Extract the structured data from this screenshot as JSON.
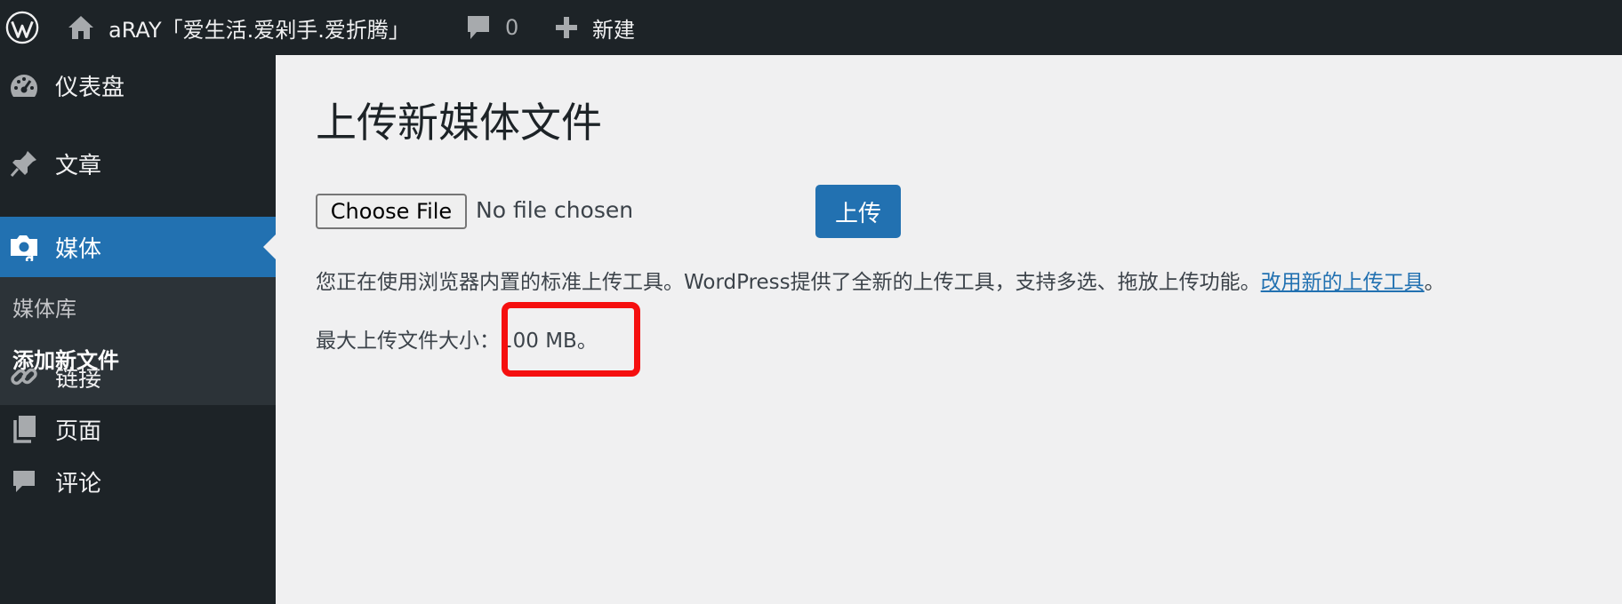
{
  "adminbar": {
    "site_name": "aRAY「爱生活.爱剁手.爱折腾」",
    "comments_count": "0",
    "new_label": "新建"
  },
  "sidebar": {
    "items": [
      {
        "label": "仪表盘",
        "icon": "dashboard-icon"
      },
      {
        "label": "文章",
        "icon": "pushpin-icon"
      },
      {
        "label": "媒体",
        "icon": "media-icon"
      },
      {
        "label": "链接",
        "icon": "link-icon"
      },
      {
        "label": "页面",
        "icon": "pages-icon"
      },
      {
        "label": "评论",
        "icon": "comment-icon"
      }
    ],
    "submenu": [
      {
        "label": "媒体库"
      },
      {
        "label": "添加新文件"
      }
    ]
  },
  "main": {
    "title": "上传新媒体文件",
    "file_button": "Choose File",
    "file_status": "No file chosen",
    "upload_button": "上传",
    "notice_text": "您正在使用浏览器内置的标准上传工具。WordPress提供了全新的上传工具，支持多选、拖放上传功能。",
    "notice_link": "改用新的上传工具",
    "notice_end": "。",
    "max_size_label": "最大上传文件大小：",
    "max_size_value": "100 MB。"
  },
  "colors": {
    "adminbar_bg": "#1d2327",
    "accent": "#2271b1",
    "submenu_bg": "#2c3338",
    "highlight": "#f50f0f"
  }
}
